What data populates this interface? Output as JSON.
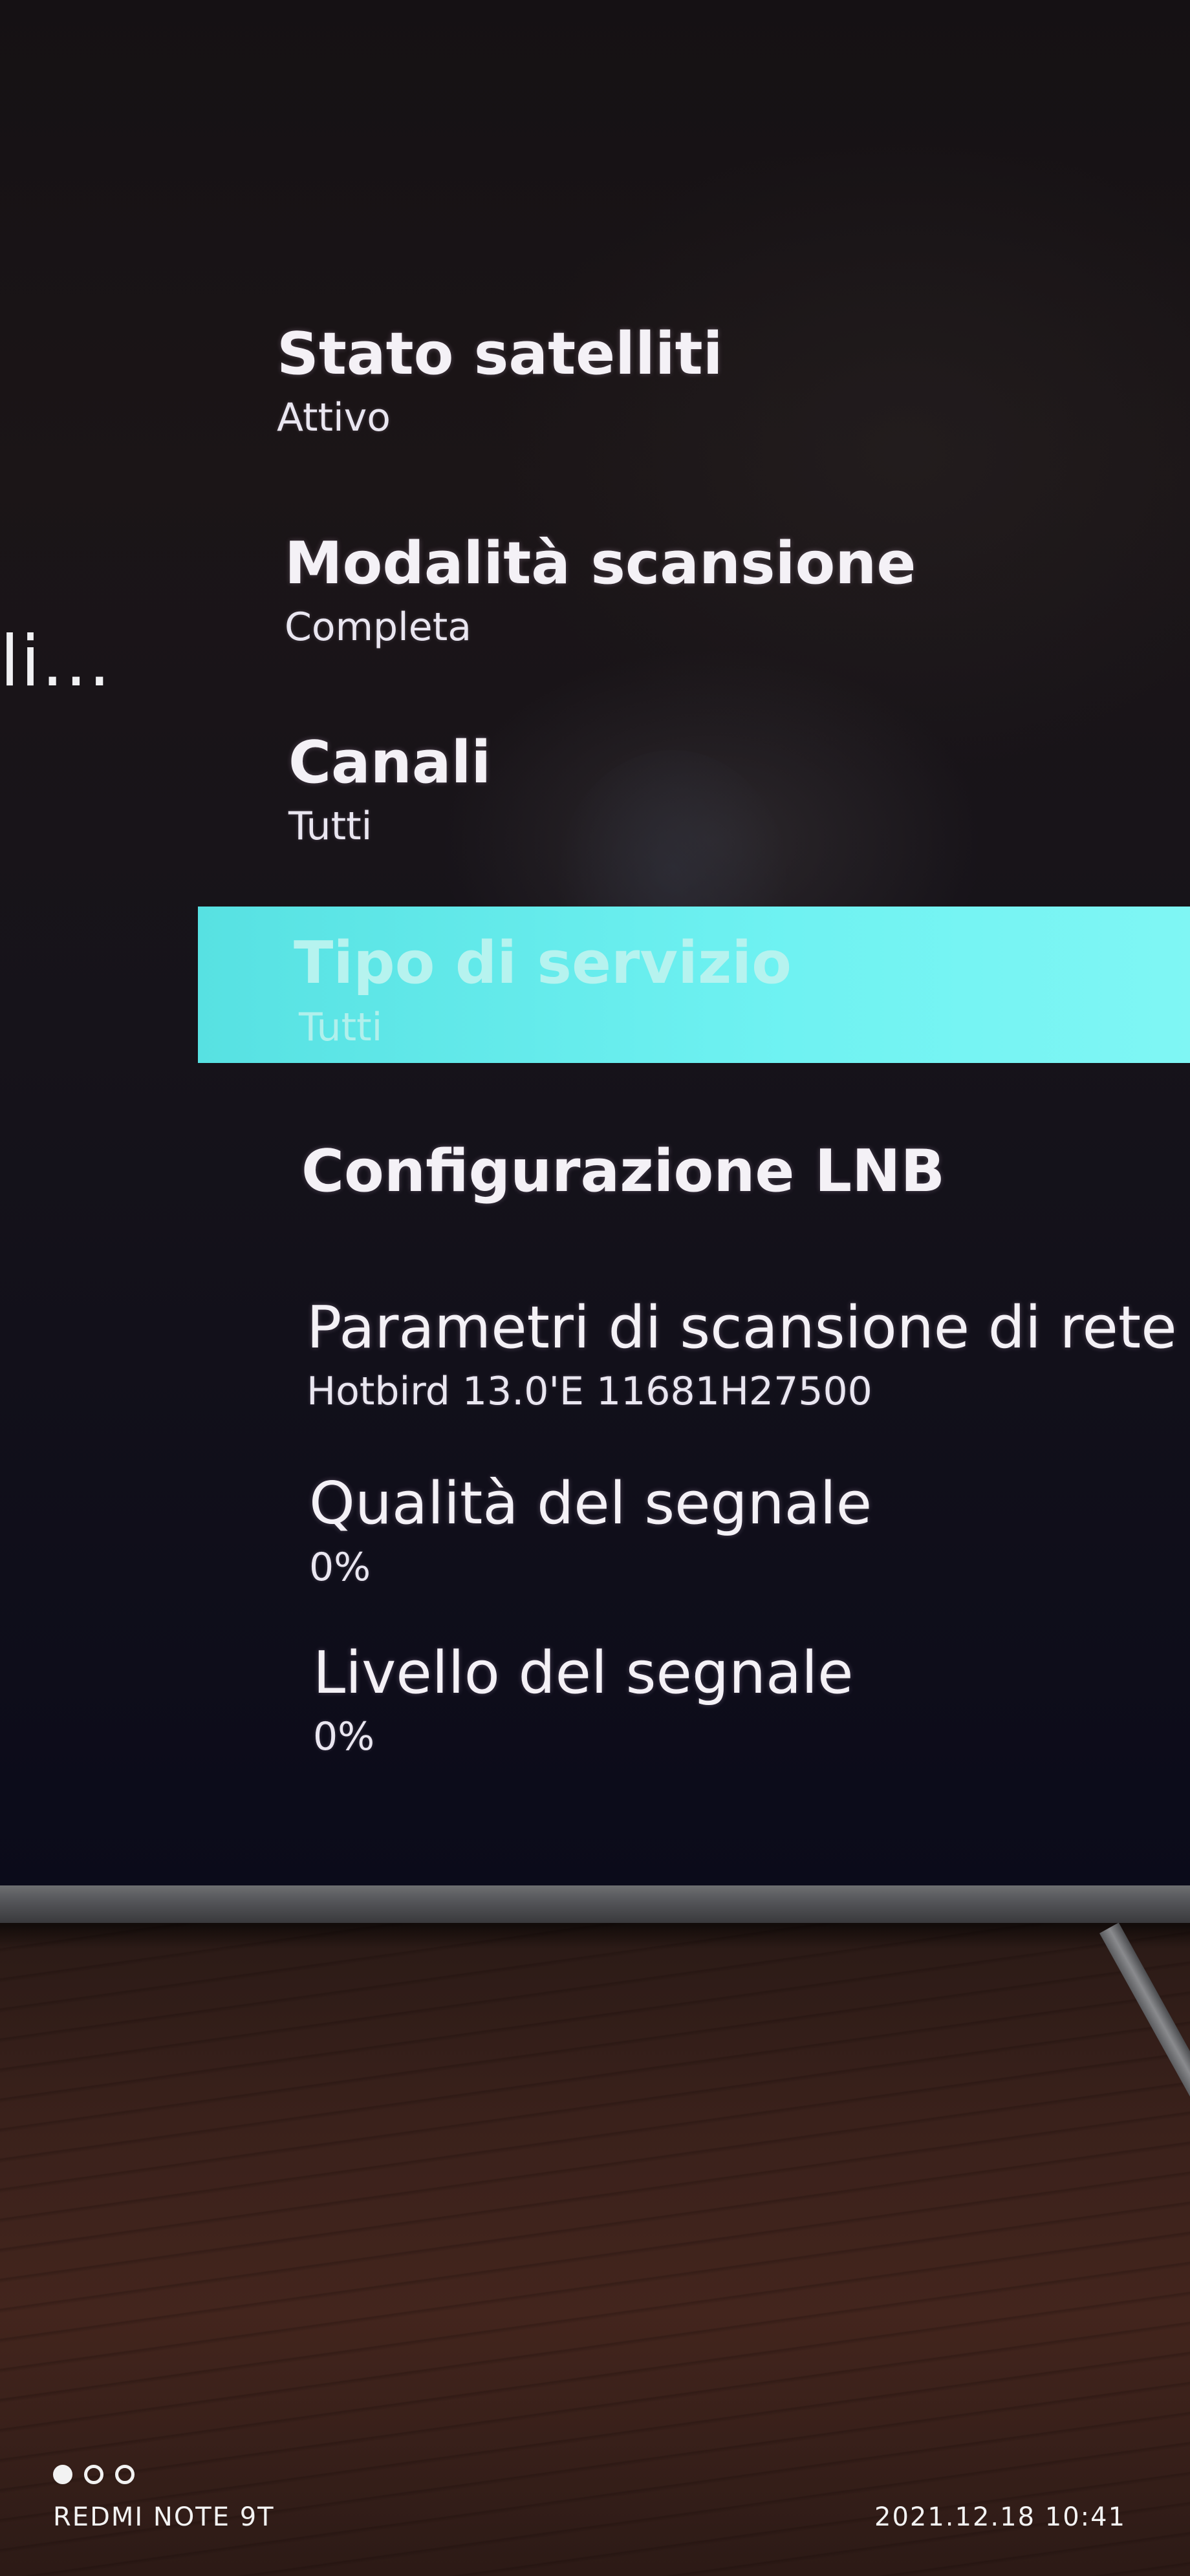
{
  "left_panel": {
    "partial_title": "li..."
  },
  "menu": {
    "stato_satelliti": {
      "title": "Stato satelliti",
      "value": "Attivo"
    },
    "modalita_scansione": {
      "title": "Modalità scansione",
      "value": "Completa"
    },
    "canali": {
      "title": "Canali",
      "value": "Tutti"
    },
    "tipo_servizio": {
      "title": "Tipo di servizio",
      "value": "Tutti",
      "selected": true
    },
    "configurazione_lnb": {
      "title": "Configurazione LNB"
    },
    "parametri_scansione": {
      "title": "Parametri di scansione di rete",
      "value": "Hotbird 13.0'E 11681H27500"
    },
    "qualita_segnale": {
      "title": "Qualità del segnale",
      "value": "0%"
    },
    "livello_segnale": {
      "title": "Livello del segnale",
      "value": "0%"
    }
  },
  "colors": {
    "highlight": "#6ff2f2",
    "text": "#f4f1f6"
  },
  "watermark": {
    "device": "REDMI NOTE 9T",
    "timestamp": "2021.12.18 10:41"
  }
}
